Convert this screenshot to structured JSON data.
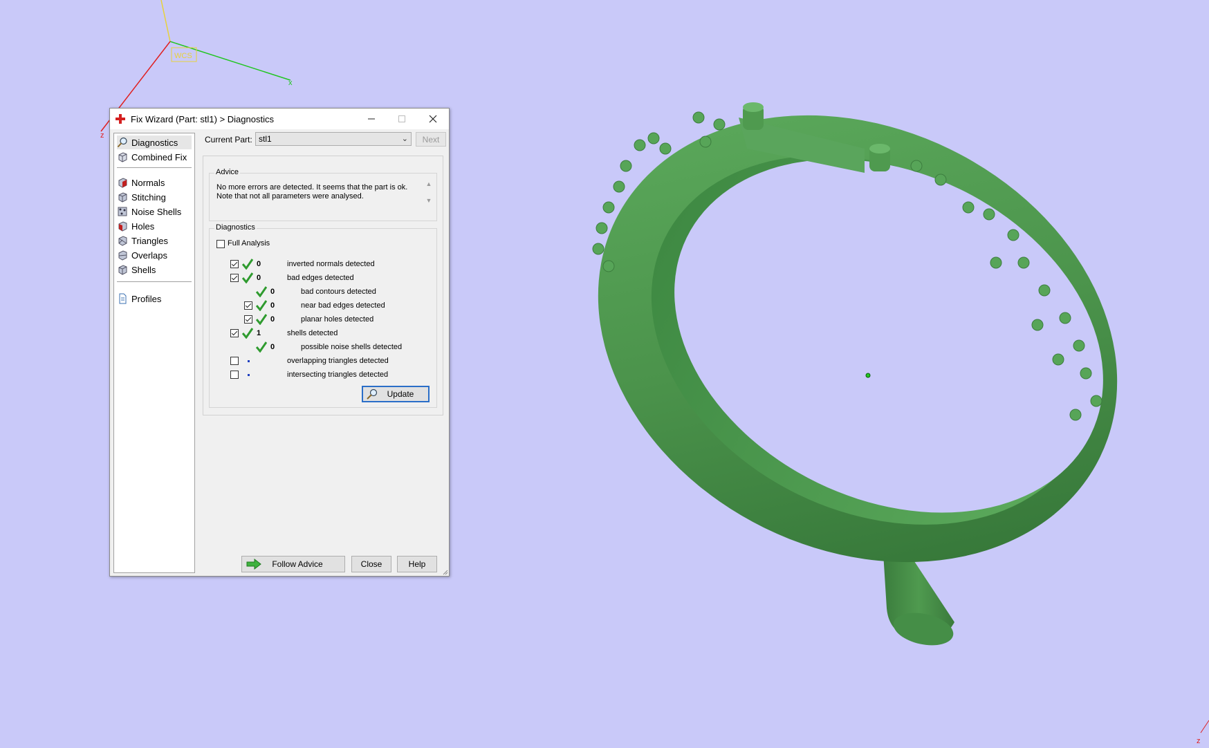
{
  "viewport": {
    "background": "#c9c9f9",
    "axis_labels": [
      "WCS",
      "x",
      "z",
      "z"
    ],
    "model_color": "#4f9a4f"
  },
  "dialog": {
    "title": "Fix Wizard (Part: stl1) > Diagnostics",
    "title_icon": "red-cross-icon",
    "controls": [
      "minimize-icon",
      "maximize-icon",
      "close-icon"
    ],
    "sidebar": {
      "top": [
        {
          "label": "Diagnostics",
          "icon": "magnifier-icon",
          "active": true
        },
        {
          "label": "Combined Fix",
          "icon": "cube-icon"
        }
      ],
      "tools": [
        {
          "label": "Normals",
          "icon": "normals-cube-icon"
        },
        {
          "label": "Stitching",
          "icon": "stitching-cube-icon"
        },
        {
          "label": "Noise Shells",
          "icon": "noise-shells-icon"
        },
        {
          "label": "Holes",
          "icon": "holes-cube-icon"
        },
        {
          "label": "Triangles",
          "icon": "triangles-cube-icon"
        },
        {
          "label": "Overlaps",
          "icon": "overlaps-cube-icon"
        },
        {
          "label": "Shells",
          "icon": "shells-cube-icon"
        }
      ],
      "bottom": [
        {
          "label": "Profiles",
          "icon": "document-icon"
        }
      ]
    },
    "current_part_label": "Current Part:",
    "current_part_value": "stl1",
    "next_label": "Next",
    "advice": {
      "title": "Advice",
      "text": "No more errors are detected. It seems that the part is ok. Note that not all parameters were analysed."
    },
    "diagnostics": {
      "title": "Diagnostics",
      "full_analysis_label": "Full Analysis",
      "full_analysis_checked": false,
      "rows": [
        {
          "count": "0",
          "label": "inverted normals detected",
          "checked": true,
          "has_checkbox": true,
          "status": "ok",
          "indent": 0
        },
        {
          "count": "0",
          "label": "bad edges detected",
          "checked": true,
          "has_checkbox": true,
          "status": "ok",
          "indent": 0
        },
        {
          "count": "0",
          "label": "bad contours detected",
          "checked": false,
          "has_checkbox": false,
          "status": "ok",
          "indent": 1
        },
        {
          "count": "0",
          "label": "near bad edges detected",
          "checked": true,
          "has_checkbox": true,
          "status": "ok",
          "indent": 1
        },
        {
          "count": "0",
          "label": "planar holes detected",
          "checked": true,
          "has_checkbox": true,
          "status": "ok",
          "indent": 1
        },
        {
          "count": "1",
          "label": "shells detected",
          "checked": true,
          "has_checkbox": true,
          "status": "ok",
          "indent": 0
        },
        {
          "count": "0",
          "label": "possible noise shells detected",
          "checked": false,
          "has_checkbox": false,
          "status": "ok",
          "indent": 1
        },
        {
          "count": "",
          "label": "overlapping triangles detected",
          "checked": false,
          "has_checkbox": true,
          "status": "none",
          "indent": 0
        },
        {
          "count": "",
          "label": "intersecting triangles detected",
          "checked": false,
          "has_checkbox": true,
          "status": "none",
          "indent": 0
        }
      ],
      "update_label": "Update"
    },
    "buttons": {
      "follow_advice": "Follow Advice",
      "close": "Close",
      "help": "Help"
    },
    "accent": "#2f9b2f"
  }
}
